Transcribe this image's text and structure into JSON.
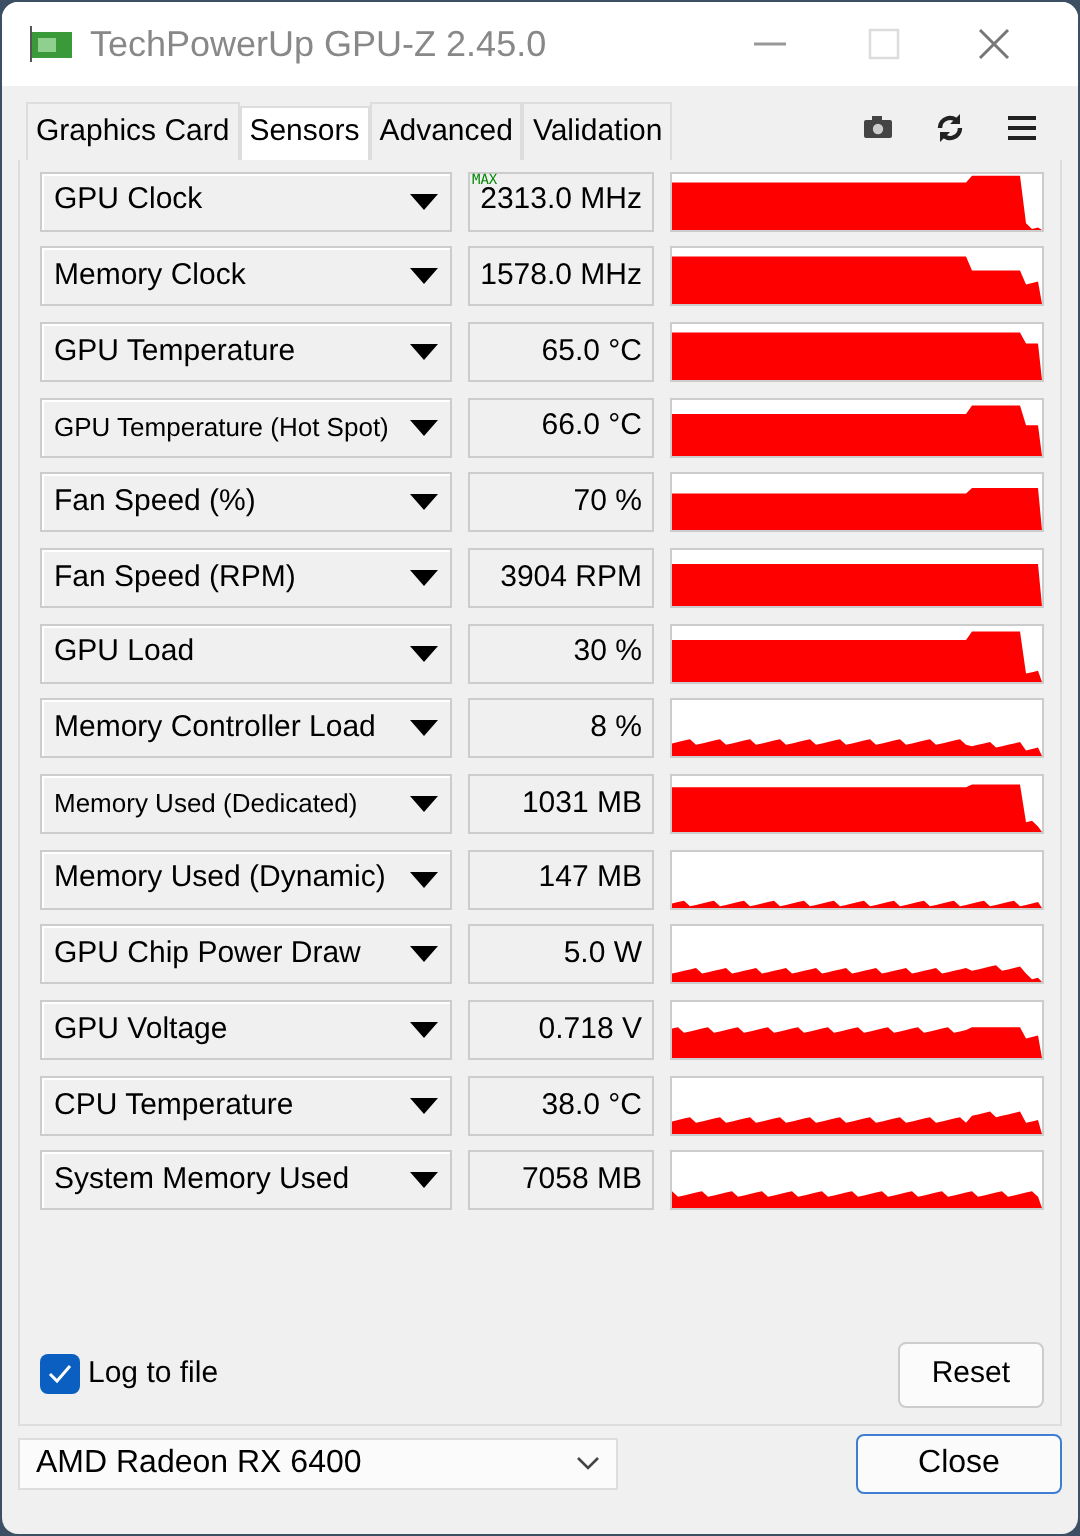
{
  "window": {
    "title": "TechPowerUp GPU-Z 2.45.0"
  },
  "tabs": [
    {
      "label": "Graphics Card",
      "selected": false
    },
    {
      "label": "Sensors",
      "selected": true
    },
    {
      "label": "Advanced",
      "selected": false
    },
    {
      "label": "Validation",
      "selected": false
    }
  ],
  "sensors": [
    {
      "name": "GPU Clock",
      "value": "2313.0 MHz",
      "badge": "MAX"
    },
    {
      "name": "Memory Clock",
      "value": "1578.0 MHz"
    },
    {
      "name": "GPU Temperature",
      "value": "65.0 °C"
    },
    {
      "name": "GPU Temperature (Hot Spot)",
      "value": "66.0 °C"
    },
    {
      "name": "Fan Speed (%)",
      "value": "70 %"
    },
    {
      "name": "Fan Speed (RPM)",
      "value": "3904 RPM"
    },
    {
      "name": "GPU Load",
      "value": "30 %"
    },
    {
      "name": "Memory Controller Load",
      "value": "8 %"
    },
    {
      "name": "Memory Used (Dedicated)",
      "value": "1031 MB"
    },
    {
      "name": "Memory Used (Dynamic)",
      "value": "147 MB"
    },
    {
      "name": "GPU Chip Power Draw",
      "value": "5.0 W"
    },
    {
      "name": "GPU Voltage",
      "value": "0.718 V"
    },
    {
      "name": "CPU Temperature",
      "value": "38.0 °C"
    },
    {
      "name": "System Memory Used",
      "value": "7058 MB"
    }
  ],
  "log_to_file": {
    "label": "Log to file",
    "checked": true
  },
  "reset_button": "Reset",
  "device": {
    "value": "AMD Radeon RX 6400"
  },
  "close_button": "Close"
}
